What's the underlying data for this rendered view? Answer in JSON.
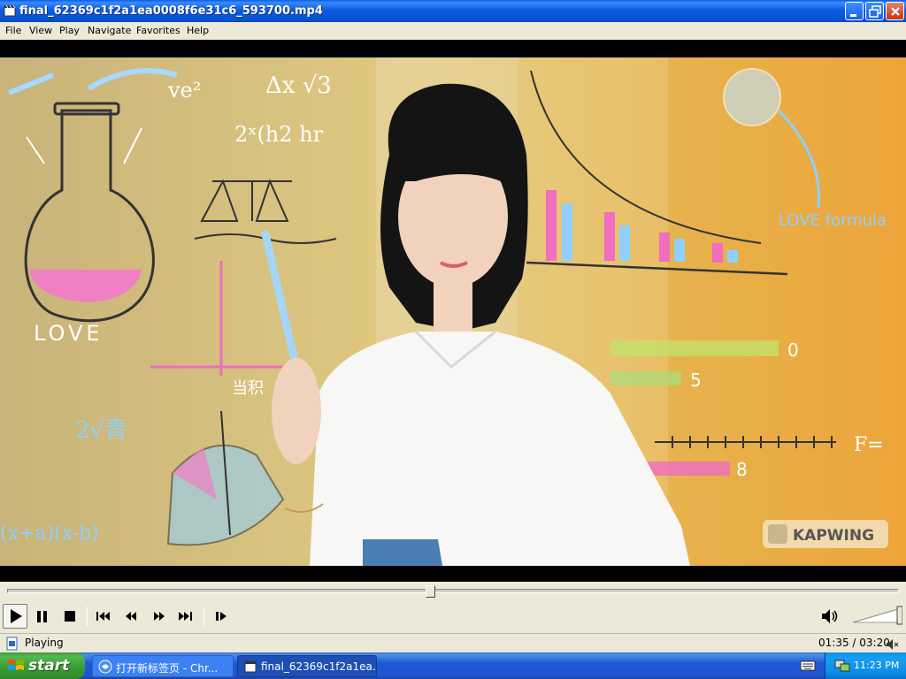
{
  "window": {
    "title": "final_62369c1f2a1ea0008f6e31c6_593700.mp4"
  },
  "menu": {
    "items": [
      "File",
      "View",
      "Play",
      "Navigate",
      "Favorites",
      "Help"
    ]
  },
  "video": {
    "scene_texts": [
      "LOVE",
      "LOVE formula",
      "KAPWING",
      "0",
      "5",
      "8"
    ],
    "watermark": "KAPWING"
  },
  "playback": {
    "progress": 0.474,
    "status": "Playing",
    "time": "01:35 / 03:20",
    "volume": 1.0
  },
  "icons": {
    "play": "play-icon",
    "pause": "pause-icon",
    "stop": "stop-icon",
    "prev": "skip-previous-icon",
    "rewind": "rewind-icon",
    "forward": "fast-forward-icon",
    "next": "skip-next-icon",
    "frame_step": "frame-step-icon",
    "volume": "speaker-icon"
  },
  "taskbar": {
    "start_label": "start",
    "tasks": [
      "打开新标签页 - Chr...",
      "final_62369c1f2a1ea..."
    ],
    "clock": "11:23 PM"
  }
}
